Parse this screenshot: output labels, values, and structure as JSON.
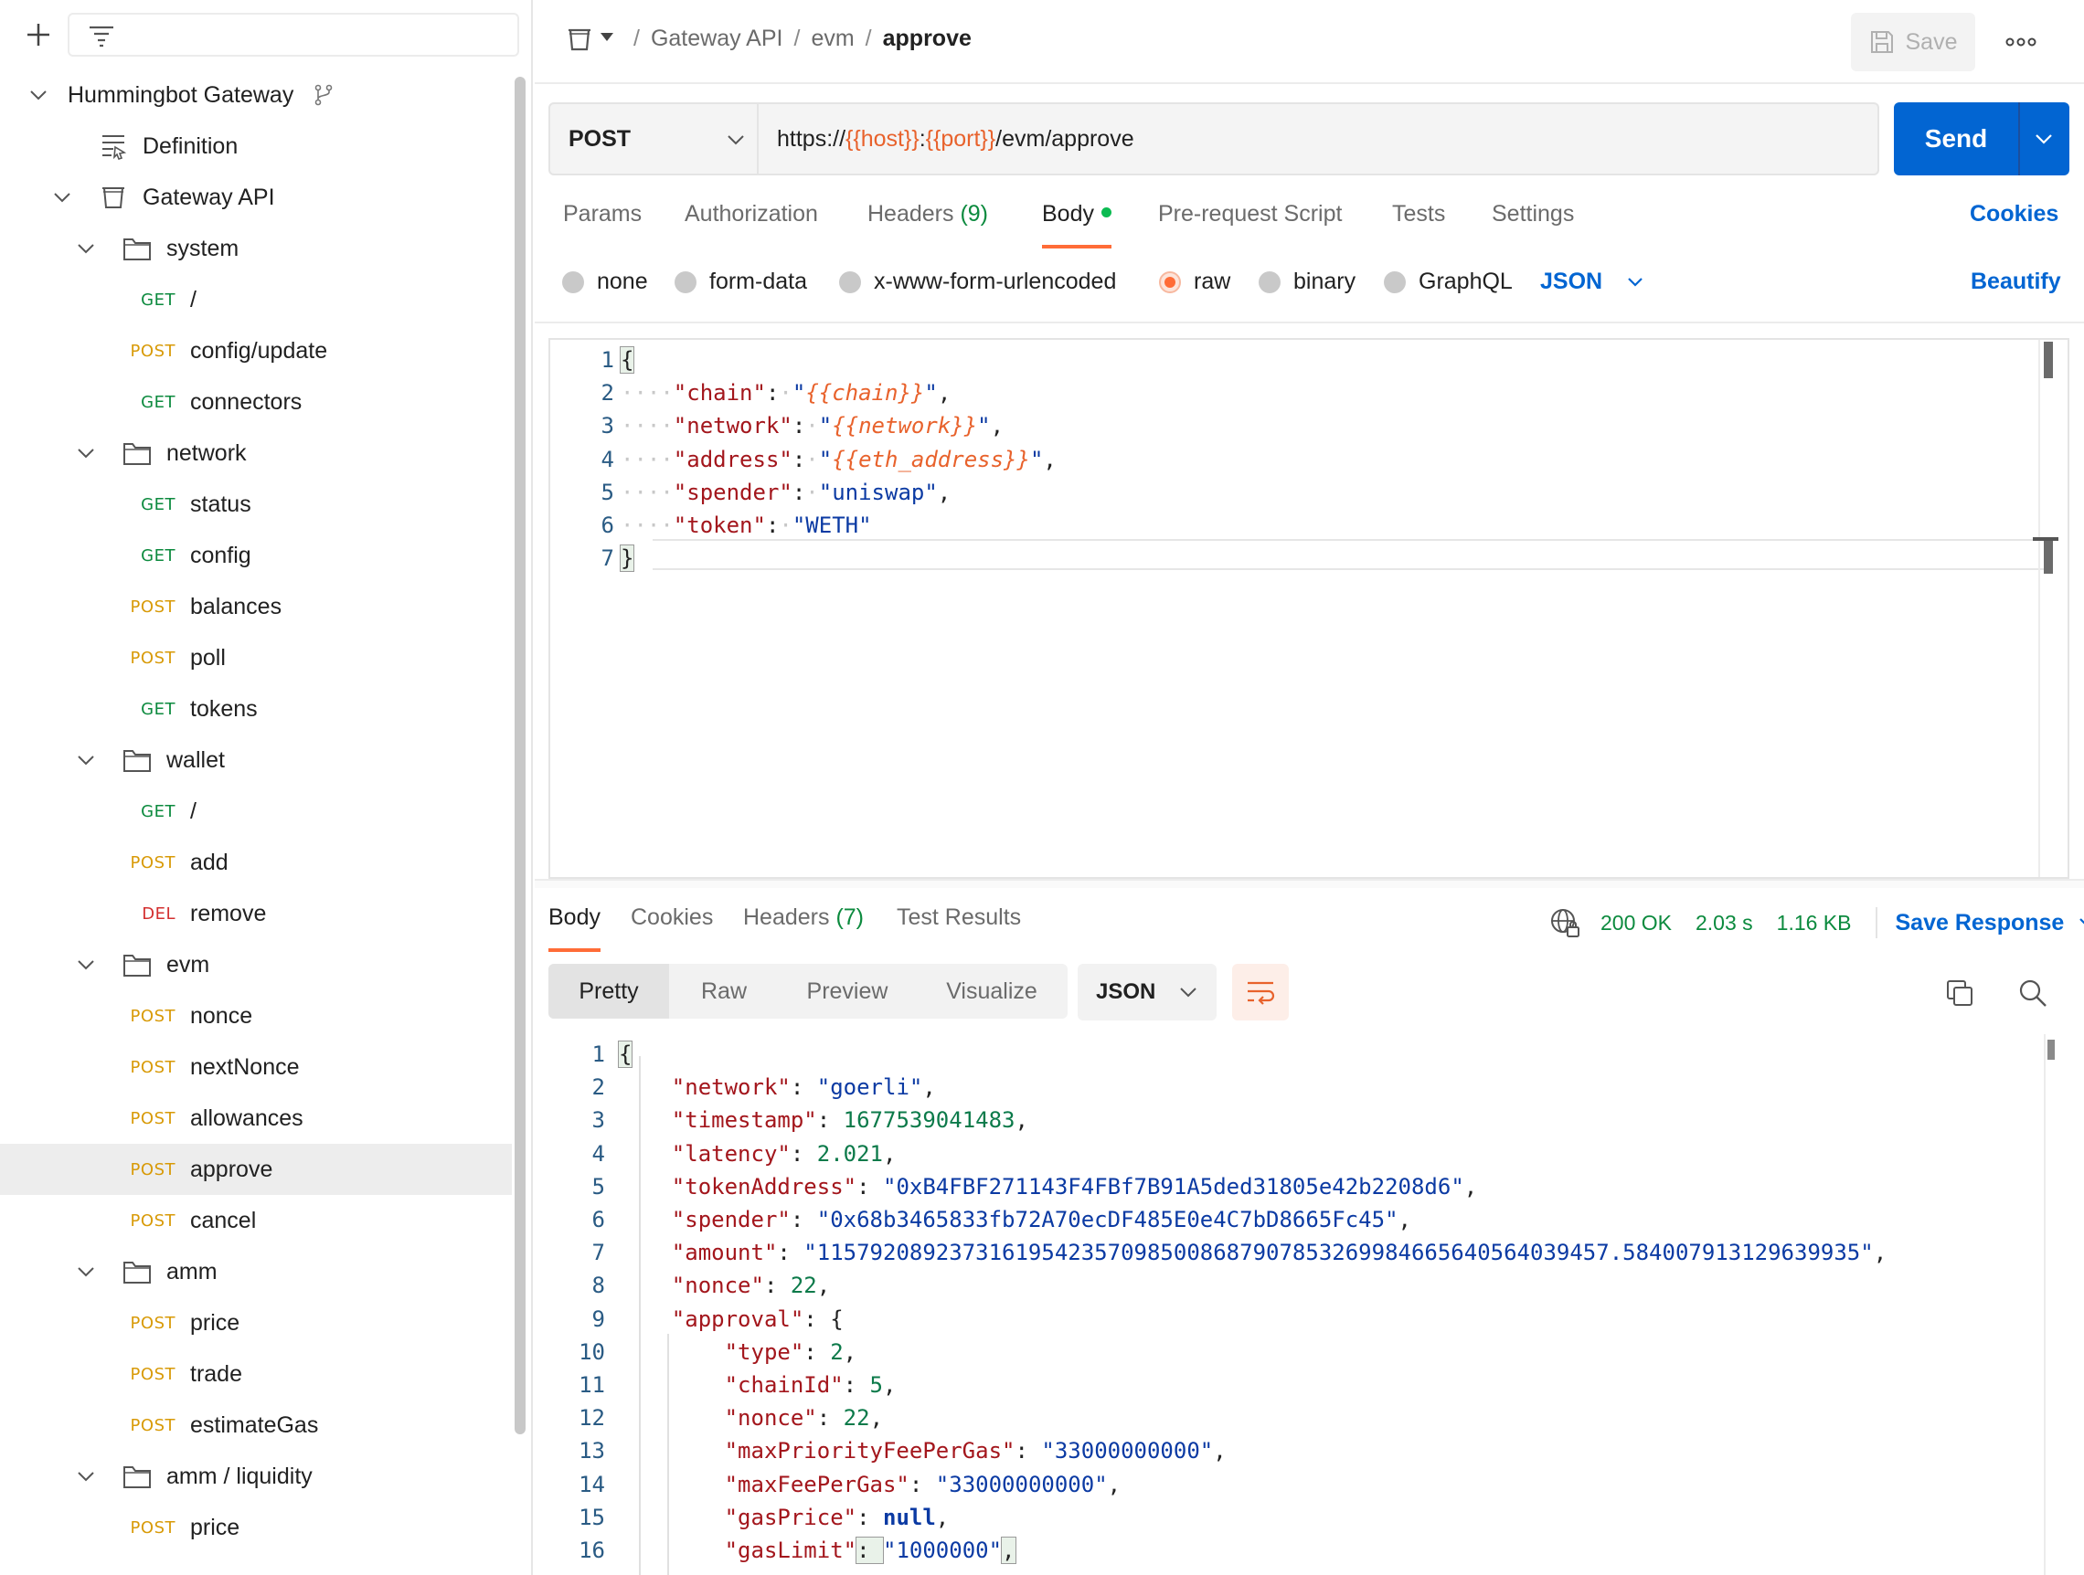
{
  "sidebar": {
    "collection": "Hummingbot Gateway",
    "items": [
      {
        "kind": "collection",
        "label": "Hummingbot Gateway",
        "depth": 0,
        "chev": true
      },
      {
        "kind": "definition",
        "label": "Definition",
        "depth": 1
      },
      {
        "kind": "api",
        "label": "Gateway API",
        "depth": 1,
        "chev": true
      },
      {
        "kind": "folder",
        "label": "system",
        "depth": 2
      },
      {
        "kind": "req",
        "method": "GET",
        "label": "/",
        "depth": 3
      },
      {
        "kind": "req",
        "method": "POST",
        "label": "config/update",
        "depth": 3
      },
      {
        "kind": "req",
        "method": "GET",
        "label": "connectors",
        "depth": 3
      },
      {
        "kind": "folder",
        "label": "network",
        "depth": 2
      },
      {
        "kind": "req",
        "method": "GET",
        "label": "status",
        "depth": 3
      },
      {
        "kind": "req",
        "method": "GET",
        "label": "config",
        "depth": 3
      },
      {
        "kind": "req",
        "method": "POST",
        "label": "balances",
        "depth": 3
      },
      {
        "kind": "req",
        "method": "POST",
        "label": "poll",
        "depth": 3
      },
      {
        "kind": "req",
        "method": "GET",
        "label": "tokens",
        "depth": 3
      },
      {
        "kind": "folder",
        "label": "wallet",
        "depth": 2
      },
      {
        "kind": "req",
        "method": "GET",
        "label": "/",
        "depth": 3
      },
      {
        "kind": "req",
        "method": "POST",
        "label": "add",
        "depth": 3
      },
      {
        "kind": "req",
        "method": "DEL",
        "label": "remove",
        "depth": 3
      },
      {
        "kind": "folder",
        "label": "evm",
        "depth": 2
      },
      {
        "kind": "req",
        "method": "POST",
        "label": "nonce",
        "depth": 3
      },
      {
        "kind": "req",
        "method": "POST",
        "label": "nextNonce",
        "depth": 3
      },
      {
        "kind": "req",
        "method": "POST",
        "label": "allowances",
        "depth": 3
      },
      {
        "kind": "req",
        "method": "POST",
        "label": "approve",
        "depth": 3,
        "selected": true
      },
      {
        "kind": "req",
        "method": "POST",
        "label": "cancel",
        "depth": 3
      },
      {
        "kind": "folder",
        "label": "amm",
        "depth": 2
      },
      {
        "kind": "req",
        "method": "POST",
        "label": "price",
        "depth": 3
      },
      {
        "kind": "req",
        "method": "POST",
        "label": "trade",
        "depth": 3
      },
      {
        "kind": "req",
        "method": "POST",
        "label": "estimateGas",
        "depth": 3
      },
      {
        "kind": "folder",
        "label": "amm / liquidity",
        "depth": 2
      },
      {
        "kind": "req",
        "method": "POST",
        "label": "price",
        "depth": 3
      }
    ]
  },
  "header": {
    "breadcrumb": [
      "Gateway API",
      "evm",
      "approve"
    ],
    "save_label": "Save"
  },
  "request": {
    "method": "POST",
    "url_parts": [
      {
        "text": "https://",
        "var": false
      },
      {
        "text": "{{host}}",
        "var": true
      },
      {
        "text": ":",
        "var": false
      },
      {
        "text": "{{port}}",
        "var": true
      },
      {
        "text": "/evm/approve",
        "var": false
      }
    ],
    "send_label": "Send",
    "tabs": [
      {
        "label": "Params"
      },
      {
        "label": "Authorization"
      },
      {
        "label": "Headers",
        "count": "(9)"
      },
      {
        "label": "Body",
        "active": true,
        "dot": true
      },
      {
        "label": "Pre-request Script"
      },
      {
        "label": "Tests"
      },
      {
        "label": "Settings"
      }
    ],
    "cookies_label": "Cookies",
    "body_modes": [
      "none",
      "form-data",
      "x-www-form-urlencoded",
      "raw",
      "binary",
      "GraphQL"
    ],
    "body_mode_selected": "raw",
    "body_format": "JSON",
    "beautify_label": "Beautify",
    "body_lines": [
      [
        [
          "p",
          "{"
        ]
      ],
      [
        [
          "ws",
          "····"
        ],
        [
          "k",
          "\"chain\""
        ],
        [
          "p",
          ":"
        ],
        [
          "ws",
          "·"
        ],
        [
          "s",
          "\""
        ],
        [
          "vi",
          "{{chain}}"
        ],
        [
          "s",
          "\""
        ],
        [
          "p",
          ","
        ]
      ],
      [
        [
          "ws",
          "····"
        ],
        [
          "k",
          "\"network\""
        ],
        [
          "p",
          ":"
        ],
        [
          "ws",
          "·"
        ],
        [
          "s",
          "\""
        ],
        [
          "vi",
          "{{network}}"
        ],
        [
          "s",
          "\""
        ],
        [
          "p",
          ","
        ]
      ],
      [
        [
          "ws",
          "····"
        ],
        [
          "k",
          "\"address\""
        ],
        [
          "p",
          ":"
        ],
        [
          "ws",
          "·"
        ],
        [
          "s",
          "\""
        ],
        [
          "vi",
          "{{eth_address}}"
        ],
        [
          "s",
          "\""
        ],
        [
          "p",
          ","
        ]
      ],
      [
        [
          "ws",
          "····"
        ],
        [
          "k",
          "\"spender\""
        ],
        [
          "p",
          ":"
        ],
        [
          "ws",
          "·"
        ],
        [
          "s",
          "\"uniswap\""
        ],
        [
          "p",
          ","
        ]
      ],
      [
        [
          "ws",
          "····"
        ],
        [
          "k",
          "\"token\""
        ],
        [
          "p",
          ":"
        ],
        [
          "ws",
          "·"
        ],
        [
          "s",
          "\"WETH\""
        ]
      ],
      [
        [
          "p",
          "}"
        ]
      ]
    ]
  },
  "response": {
    "tabs": [
      {
        "label": "Body",
        "active": true
      },
      {
        "label": "Cookies"
      },
      {
        "label": "Headers",
        "count": "(7)"
      },
      {
        "label": "Test Results"
      }
    ],
    "status": "200 OK",
    "time": "2.03 s",
    "size": "1.16 KB",
    "save_response_label": "Save Response",
    "views": [
      "Pretty",
      "Raw",
      "Preview",
      "Visualize"
    ],
    "view_selected": "Pretty",
    "format": "JSON",
    "body_lines": [
      [
        [
          "p",
          "{"
        ]
      ],
      [
        [
          "p",
          "    "
        ],
        [
          "k",
          "\"network\""
        ],
        [
          "p",
          ": "
        ],
        [
          "s",
          "\"goerli\""
        ],
        [
          "p",
          ","
        ]
      ],
      [
        [
          "p",
          "    "
        ],
        [
          "k",
          "\"timestamp\""
        ],
        [
          "p",
          ": "
        ],
        [
          "n",
          "1677539041483"
        ],
        [
          "p",
          ","
        ]
      ],
      [
        [
          "p",
          "    "
        ],
        [
          "k",
          "\"latency\""
        ],
        [
          "p",
          ": "
        ],
        [
          "n",
          "2.021"
        ],
        [
          "p",
          ","
        ]
      ],
      [
        [
          "p",
          "    "
        ],
        [
          "k",
          "\"tokenAddress\""
        ],
        [
          "p",
          ": "
        ],
        [
          "s",
          "\"0xB4FBF271143F4FBf7B91A5ded31805e42b2208d6\""
        ],
        [
          "p",
          ","
        ]
      ],
      [
        [
          "p",
          "    "
        ],
        [
          "k",
          "\"spender\""
        ],
        [
          "p",
          ": "
        ],
        [
          "s",
          "\"0x68b3465833fb72A70ecDF485E0e4C7bD8665Fc45\""
        ],
        [
          "p",
          ","
        ]
      ],
      [
        [
          "p",
          "    "
        ],
        [
          "k",
          "\"amount\""
        ],
        [
          "p",
          ": "
        ],
        [
          "s",
          "\"115792089237316195423570985008687907853269984665640564039457.584007913129639935\""
        ],
        [
          "p",
          ","
        ]
      ],
      [
        [
          "p",
          "    "
        ],
        [
          "k",
          "\"nonce\""
        ],
        [
          "p",
          ": "
        ],
        [
          "n",
          "22"
        ],
        [
          "p",
          ","
        ]
      ],
      [
        [
          "p",
          "    "
        ],
        [
          "k",
          "\"approval\""
        ],
        [
          "p",
          ": {"
        ]
      ],
      [
        [
          "p",
          "        "
        ],
        [
          "k",
          "\"type\""
        ],
        [
          "p",
          ": "
        ],
        [
          "n",
          "2"
        ],
        [
          "p",
          ","
        ]
      ],
      [
        [
          "p",
          "        "
        ],
        [
          "k",
          "\"chainId\""
        ],
        [
          "p",
          ": "
        ],
        [
          "n",
          "5"
        ],
        [
          "p",
          ","
        ]
      ],
      [
        [
          "p",
          "        "
        ],
        [
          "k",
          "\"nonce\""
        ],
        [
          "p",
          ": "
        ],
        [
          "n",
          "22"
        ],
        [
          "p",
          ","
        ]
      ],
      [
        [
          "p",
          "        "
        ],
        [
          "k",
          "\"maxPriorityFeePerGas\""
        ],
        [
          "p",
          ": "
        ],
        [
          "s",
          "\"33000000000\""
        ],
        [
          "p",
          ","
        ]
      ],
      [
        [
          "p",
          "        "
        ],
        [
          "k",
          "\"maxFeePerGas\""
        ],
        [
          "p",
          ": "
        ],
        [
          "s",
          "\"33000000000\""
        ],
        [
          "p",
          ","
        ]
      ],
      [
        [
          "p",
          "        "
        ],
        [
          "k",
          "\"gasPrice\""
        ],
        [
          "p",
          ": "
        ],
        [
          "b",
          "null"
        ],
        [
          "p",
          ","
        ]
      ],
      [
        [
          "p",
          "        "
        ],
        [
          "k",
          "\"gasLimit\""
        ],
        [
          "p",
          ": "
        ],
        [
          "s",
          "\"1000000\""
        ],
        [
          "p",
          ","
        ]
      ]
    ]
  },
  "colors": {
    "accent": "#ff6c37",
    "primary": "#0265d2",
    "get": "#0c8a3e",
    "post": "#d89a07",
    "del": "#d32f2f"
  },
  "icons": [
    "plus-icon",
    "filter-icon",
    "chevron-down-icon",
    "fork-icon",
    "definition-icon",
    "api-icon",
    "folder-icon",
    "save-icon",
    "more-icon",
    "globe-lock-icon",
    "wrap-icon",
    "copy-icon",
    "search-icon"
  ]
}
